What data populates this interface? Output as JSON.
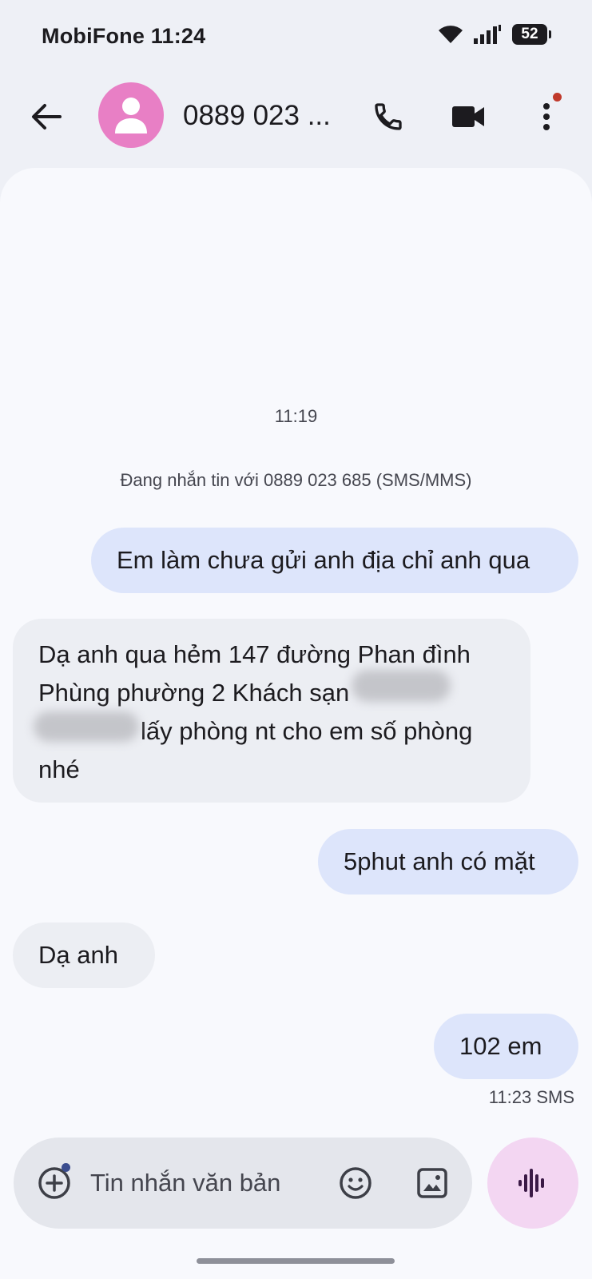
{
  "status_bar": {
    "carrier": "MobiFone",
    "time": "11:24",
    "battery": "52",
    "icons": [
      "wifi-icon",
      "signal-icon",
      "battery-icon"
    ]
  },
  "header": {
    "contact_name": "0889 023 ...",
    "icons": [
      "back-arrow-icon",
      "contact-avatar-icon",
      "phone-icon",
      "video-camera-icon",
      "more-vert-icon"
    ]
  },
  "conversation": {
    "timestamp": "11:19",
    "info": "Đang nhắn tin với 0889 023 685 (SMS/MMS)",
    "messages": [
      {
        "direction": "outgoing",
        "text": "Em làm chưa gửi anh địa chỉ anh qua"
      },
      {
        "direction": "incoming",
        "text": "Dạ anh qua hẻm 147 đường Phan đình Phùng phường 2 Khách sạn [blurred] lấy phòng nt cho em số phòng nhé",
        "lines": [
          "Dạ anh qua hẻm 147 đường Phan đình",
          "Phùng phường 2 Khách sạn",
          "lấy phòng nt cho em số phòng",
          "nhé"
        ]
      },
      {
        "direction": "outgoing",
        "text": "5phut anh có mặt"
      },
      {
        "direction": "incoming",
        "text": "Dạ anh"
      },
      {
        "direction": "outgoing",
        "text": "102 em"
      }
    ],
    "last_meta": "11:23 SMS"
  },
  "composer": {
    "placeholder": "Tin nhắn văn bản",
    "icons": [
      "add-circle-icon",
      "emoji-icon",
      "gallery-icon",
      "voice-waveform-icon"
    ]
  },
  "colors": {
    "background": "#eef0f6",
    "panel": "#f8f9fd",
    "outgoing_bubble": "#dde5fb",
    "incoming_bubble": "#eceef3",
    "avatar": "#e87fc5",
    "voice_button": "#f3d6f2"
  }
}
